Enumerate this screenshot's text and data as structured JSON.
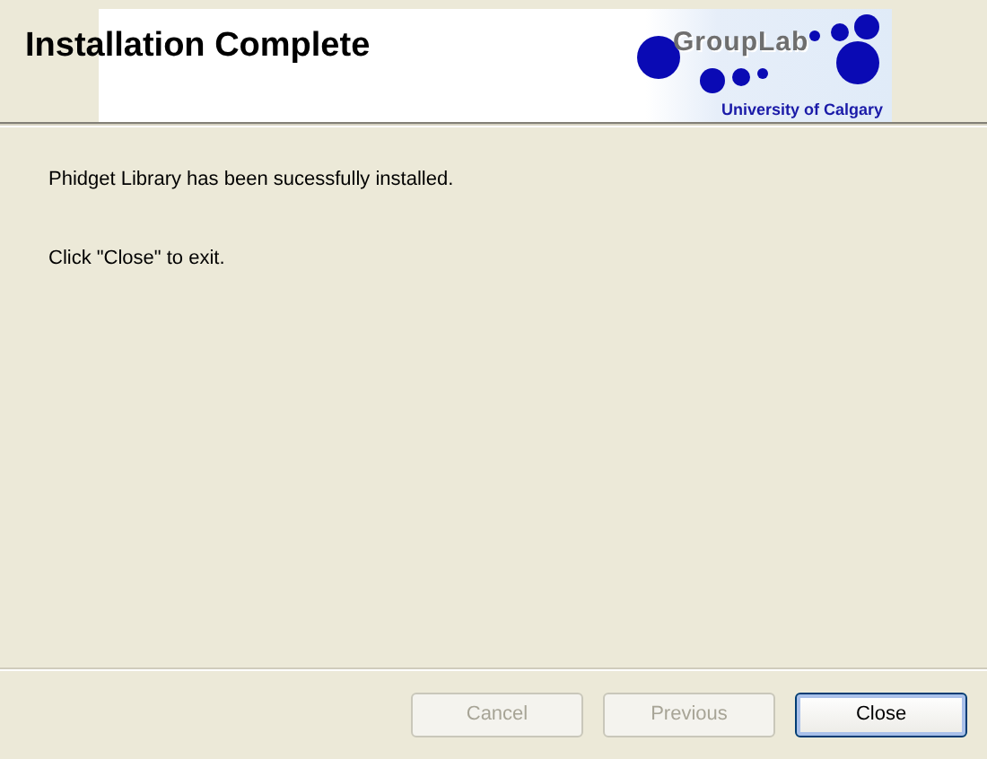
{
  "header": {
    "title": "Installation Complete",
    "logo": {
      "name": "GroupLab",
      "subtitle": "University of Calgary"
    }
  },
  "messages": [
    "Phidget Library has been sucessfully installed.",
    "Click \"Close\" to exit."
  ],
  "buttons": [
    {
      "label": "Cancel",
      "disabled": true,
      "default": false
    },
    {
      "label": "Previous",
      "disabled": true,
      "default": false
    },
    {
      "label": "Close",
      "disabled": false,
      "default": true
    }
  ]
}
